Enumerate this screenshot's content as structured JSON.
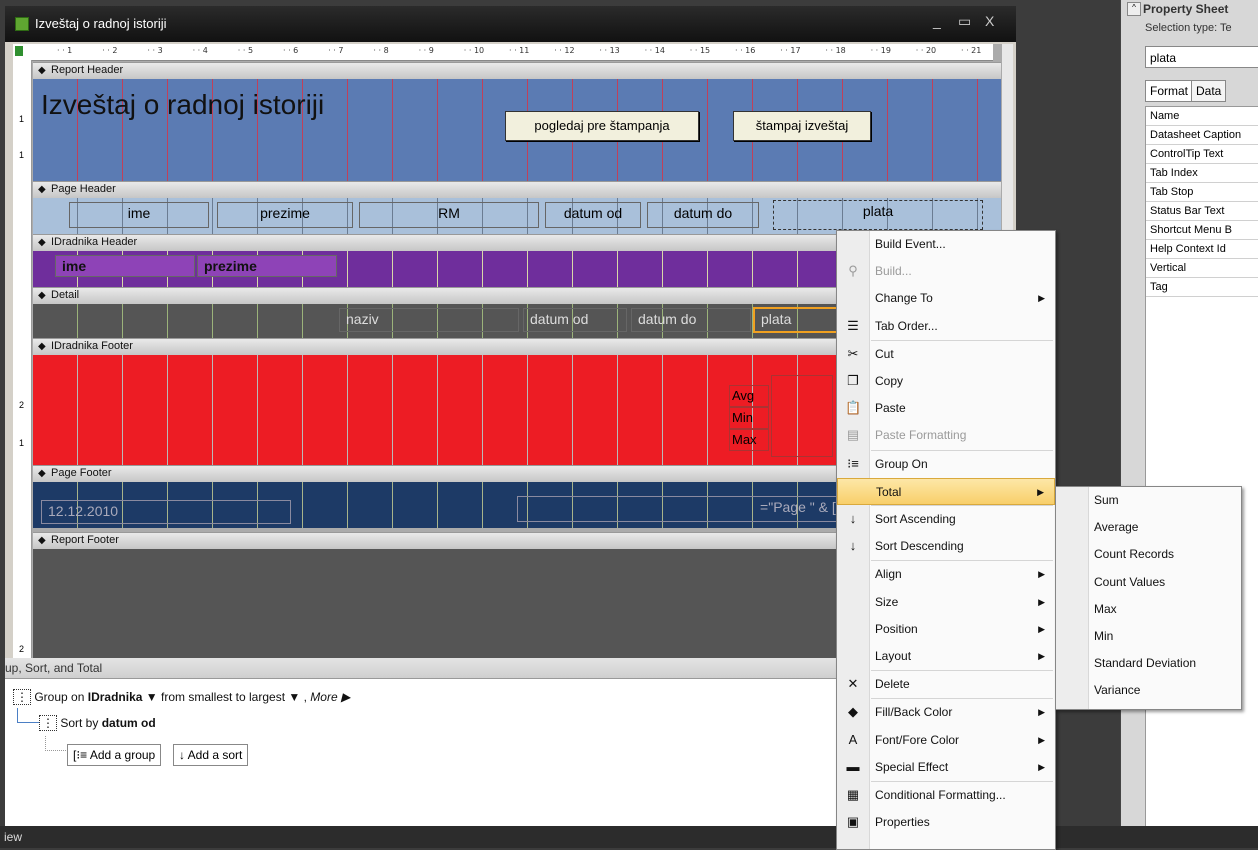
{
  "window": {
    "title": "Izveštaj o radnoj istoriji",
    "min": "_",
    "max": "▭",
    "close": "X"
  },
  "ruler": {
    "ticks": [
      "1",
      "2",
      "3",
      "4",
      "5",
      "6",
      "7",
      "8",
      "9",
      "10",
      "11",
      "12",
      "13",
      "14",
      "15",
      "16",
      "17",
      "18",
      "19",
      "20",
      "21"
    ]
  },
  "vruler": [
    "1",
    "1",
    "2",
    "1",
    "2"
  ],
  "sections": {
    "report_header": "Report Header",
    "page_header": "Page Header",
    "group_header": "IDradnika Header",
    "detail": "Detail",
    "group_footer": "IDradnika Footer",
    "page_footer": "Page Footer",
    "report_footer": "Report Footer"
  },
  "report_header": {
    "title": "Izveštaj o radnoj istoriji",
    "preview_btn": "pogledaj pre štampanja",
    "print_btn": "štampaj izveštaj"
  },
  "page_header": {
    "cols": [
      "ime",
      "prezime",
      "RM",
      "datum od",
      "datum do",
      "plata"
    ]
  },
  "group_header": {
    "fields": [
      "ime",
      "prezime"
    ]
  },
  "detail": {
    "fields": [
      "naziv",
      "datum od",
      "datum do",
      "plata"
    ]
  },
  "group_footer": {
    "labels": [
      "Avg",
      "Min",
      "Max"
    ]
  },
  "page_footer": {
    "date": "12.12.2010",
    "page_expr": "=\"Page \" & [Page] & \" of"
  },
  "group_sort": {
    "header": "up, Sort, and Total",
    "group_on_prefix": "Group on",
    "group_field": "IDradnika",
    "order": "from smallest to largest",
    "more": "More ▶",
    "sort_prefix": "Sort by",
    "sort_field": "datum od",
    "add_group": "Add a group",
    "add_sort": "Add a sort"
  },
  "status": {
    "text": "iew"
  },
  "property_sheet": {
    "title": "Property Sheet",
    "selection_type": "Selection type: Te",
    "control": "plata",
    "tabs": [
      "Format",
      "Data"
    ],
    "rows": [
      "Name",
      "Datasheet Caption",
      "ControlTip Text",
      "Tab Index",
      "Tab Stop",
      "Status Bar Text",
      "Shortcut Menu B",
      "Help Context Id",
      "Vertical",
      "Tag"
    ]
  },
  "context_menu": {
    "items": [
      {
        "label": "Build Event...",
        "icon": "",
        "disabled": false,
        "arrow": false
      },
      {
        "label": "Build...",
        "icon": "wand-icon",
        "disabled": true,
        "arrow": false
      },
      {
        "label": "Change To",
        "icon": "",
        "disabled": false,
        "arrow": true
      },
      {
        "label": "Tab Order...",
        "icon": "tab-order-icon",
        "disabled": false,
        "arrow": false
      },
      {
        "label": "Cut",
        "icon": "scissors-icon",
        "disabled": false,
        "arrow": false
      },
      {
        "label": "Copy",
        "icon": "copy-icon",
        "disabled": false,
        "arrow": false
      },
      {
        "label": "Paste",
        "icon": "paste-icon",
        "disabled": false,
        "arrow": false
      },
      {
        "label": "Paste Formatting",
        "icon": "paste-format-icon",
        "disabled": true,
        "arrow": false
      },
      {
        "label": "Group On",
        "icon": "group-icon",
        "disabled": false,
        "arrow": false
      },
      {
        "label": "Total",
        "icon": "",
        "disabled": false,
        "arrow": true
      },
      {
        "label": "Sort Ascending",
        "icon": "sort-asc-icon",
        "disabled": false,
        "arrow": false
      },
      {
        "label": "Sort Descending",
        "icon": "sort-desc-icon",
        "disabled": false,
        "arrow": false
      },
      {
        "label": "Align",
        "icon": "",
        "disabled": false,
        "arrow": true
      },
      {
        "label": "Size",
        "icon": "",
        "disabled": false,
        "arrow": true
      },
      {
        "label": "Position",
        "icon": "",
        "disabled": false,
        "arrow": true
      },
      {
        "label": "Layout",
        "icon": "",
        "disabled": false,
        "arrow": true
      },
      {
        "label": "Delete",
        "icon": "delete-icon",
        "disabled": false,
        "arrow": false
      },
      {
        "label": "Fill/Back Color",
        "icon": "fill-color-icon",
        "disabled": false,
        "arrow": true
      },
      {
        "label": "Font/Fore Color",
        "icon": "font-color-icon",
        "disabled": false,
        "arrow": true
      },
      {
        "label": "Special Effect",
        "icon": "special-effect-icon",
        "disabled": false,
        "arrow": true
      },
      {
        "label": "Conditional Formatting...",
        "icon": "conditional-format-icon",
        "disabled": false,
        "arrow": false
      },
      {
        "label": "Properties",
        "icon": "properties-icon",
        "disabled": false,
        "arrow": false
      }
    ]
  },
  "total_submenu": {
    "items": [
      "Sum",
      "Average",
      "Count Records",
      "Count Values",
      "Max",
      "Min",
      "Standard Deviation",
      "Variance"
    ]
  },
  "colors": {
    "report_header": "#5b7bb3",
    "group_header": "#6f2e9c",
    "group_footer": "#ed1c24",
    "page_footer": "#1d3a66",
    "detail": "#555555",
    "highlight": "#f8cf6a"
  }
}
